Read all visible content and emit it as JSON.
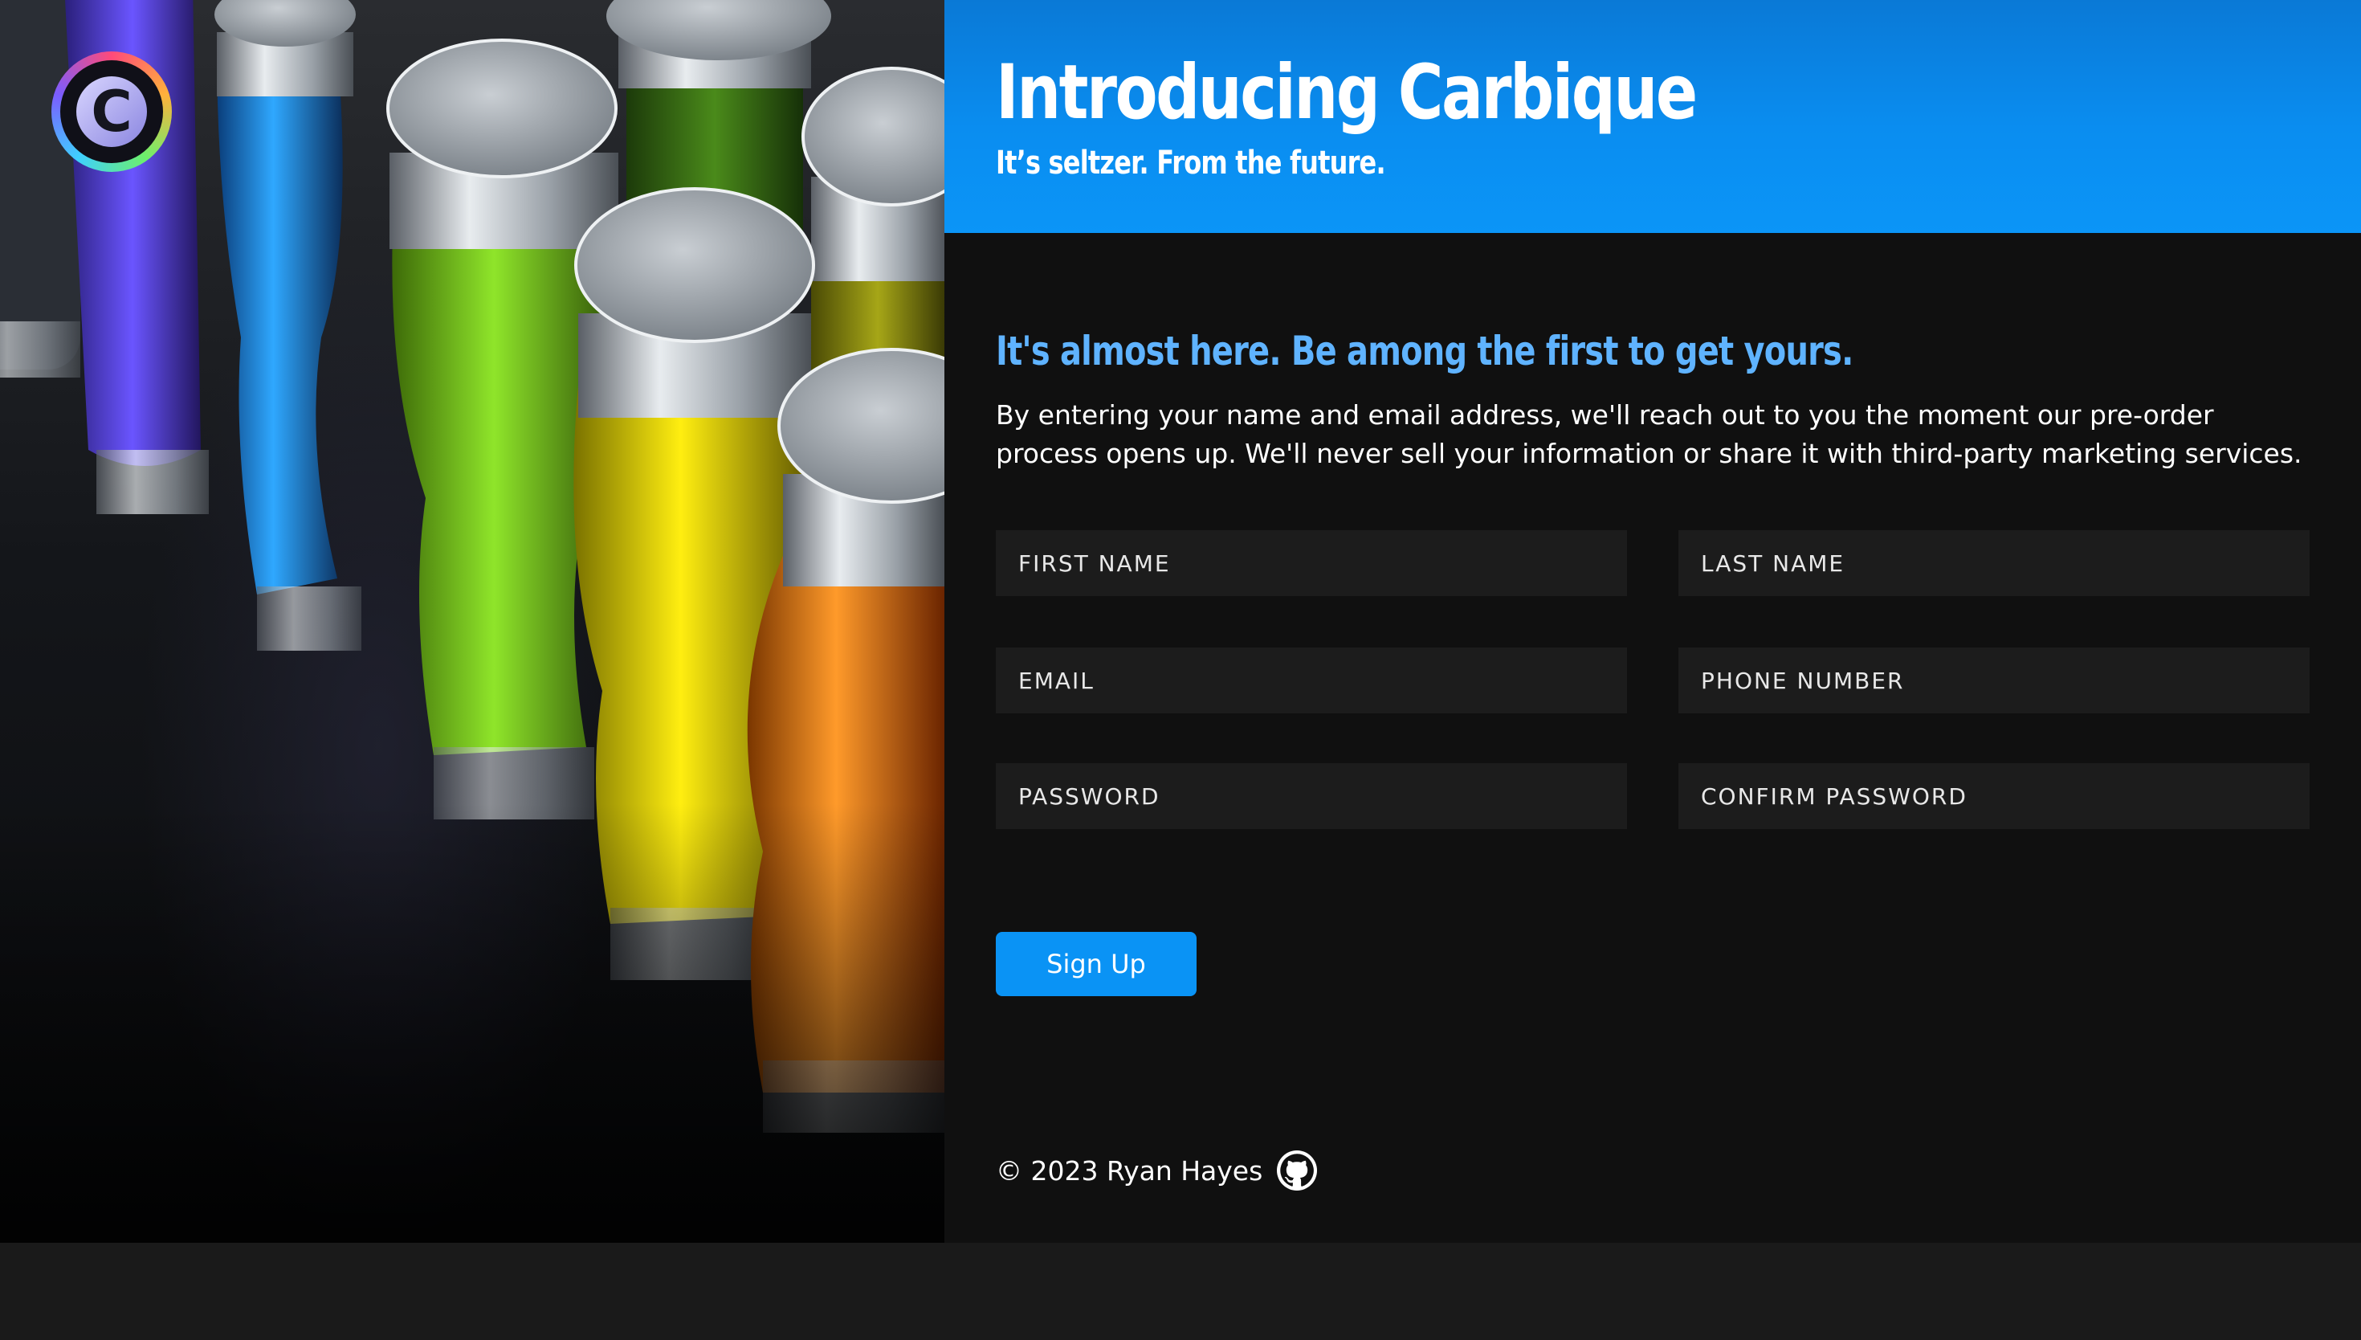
{
  "hero": {
    "logo_letter": "C",
    "logo_icon": "carbique-logo-icon"
  },
  "banner": {
    "title": "Introducing Carbique",
    "subtitle": "It’s seltzer. From the future."
  },
  "intro": {
    "headline": "It's almost here. Be among the first to get yours.",
    "description": "By entering your name and email address, we'll reach out to you the moment our pre-order process opens up. We'll never sell your information or share it with third-party marketing services."
  },
  "form": {
    "first_name_placeholder": "FIRST NAME",
    "last_name_placeholder": "LAST NAME",
    "email_placeholder": "EMAIL",
    "phone_placeholder": "PHONE NUMBER",
    "password_placeholder": "PASSWORD",
    "confirm_password_placeholder": "CONFIRM PASSWORD",
    "submit_label": "Sign Up"
  },
  "footer": {
    "copyright": "© 2023 Ryan Hayes",
    "github_icon": "github-icon"
  },
  "colors": {
    "accent": "#0a93f5",
    "headline": "#5fb3ff",
    "panel_bg": "#101010",
    "field_bg": "#1c1c1c"
  }
}
